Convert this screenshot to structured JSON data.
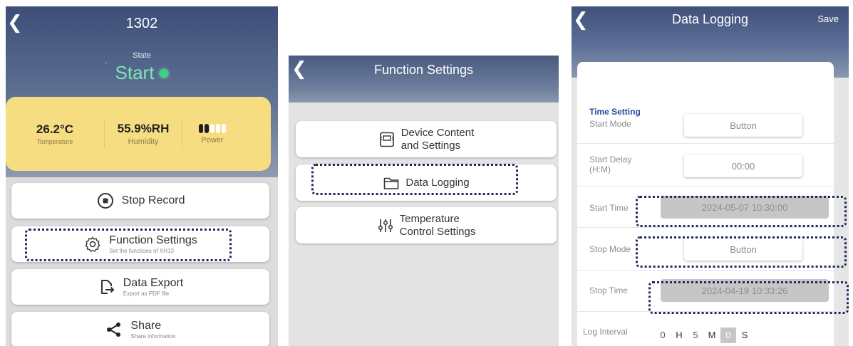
{
  "screen1": {
    "title": "1302",
    "state_label": "State",
    "state_value": "Start",
    "state_color": "#39d47d",
    "temperature_value": "26.2°C",
    "temperature_label": "Temperature",
    "humidity_value": "55.9%RH",
    "humidity_label": "Humidity",
    "power_label": "Power",
    "power_level_fraction": 0.4,
    "buttons": [
      {
        "label": "Stop Record",
        "sub": "",
        "icon": "stop-icon"
      },
      {
        "label": "Function Settings",
        "sub": "Set the functions of XH13",
        "icon": "gear-icon"
      },
      {
        "label": "Data Export",
        "sub": "Export as PDF file",
        "icon": "export-icon"
      },
      {
        "label": "Share",
        "sub": "Share information",
        "icon": "share-icon"
      }
    ]
  },
  "screen2": {
    "title": "Function Settings",
    "items": [
      {
        "label_line1": "Device Content",
        "label_line2": "and Settings",
        "icon": "device-icon"
      },
      {
        "label_line1": "Data Logging",
        "label_line2": "",
        "icon": "folder-icon"
      },
      {
        "label_line1": "Temperature",
        "label_line2": "Control Settings",
        "icon": "sliders-icon"
      }
    ]
  },
  "screen3": {
    "title": "Data Logging",
    "save_label": "Save",
    "section_title": "Time Setting",
    "start_mode_label": "Start Mode",
    "start_mode_value": "Button",
    "start_delay_label_line1": "Start Delay",
    "start_delay_label_line2": "(H:M)",
    "start_delay_value": "00:00",
    "start_time_label": "Start Time",
    "start_time_value": "2024-05-07 10:30:00",
    "stop_mode_label": "Stop Mode",
    "stop_mode_value": "Button",
    "stop_time_label": "Stop Time",
    "stop_time_value": "2024-04-19 10:33:26",
    "log_interval_label": "Log Interval",
    "log_interval": {
      "h": "0",
      "h_unit": "H",
      "m": "5",
      "m_unit": "M",
      "s": "0",
      "s_unit": "S"
    }
  },
  "colors": {
    "header_blue": "#3d4e78",
    "highlight_outline": "#1d2b5c",
    "accent_yellow": "#f6dd82",
    "section_blue": "#2a4a9e"
  }
}
